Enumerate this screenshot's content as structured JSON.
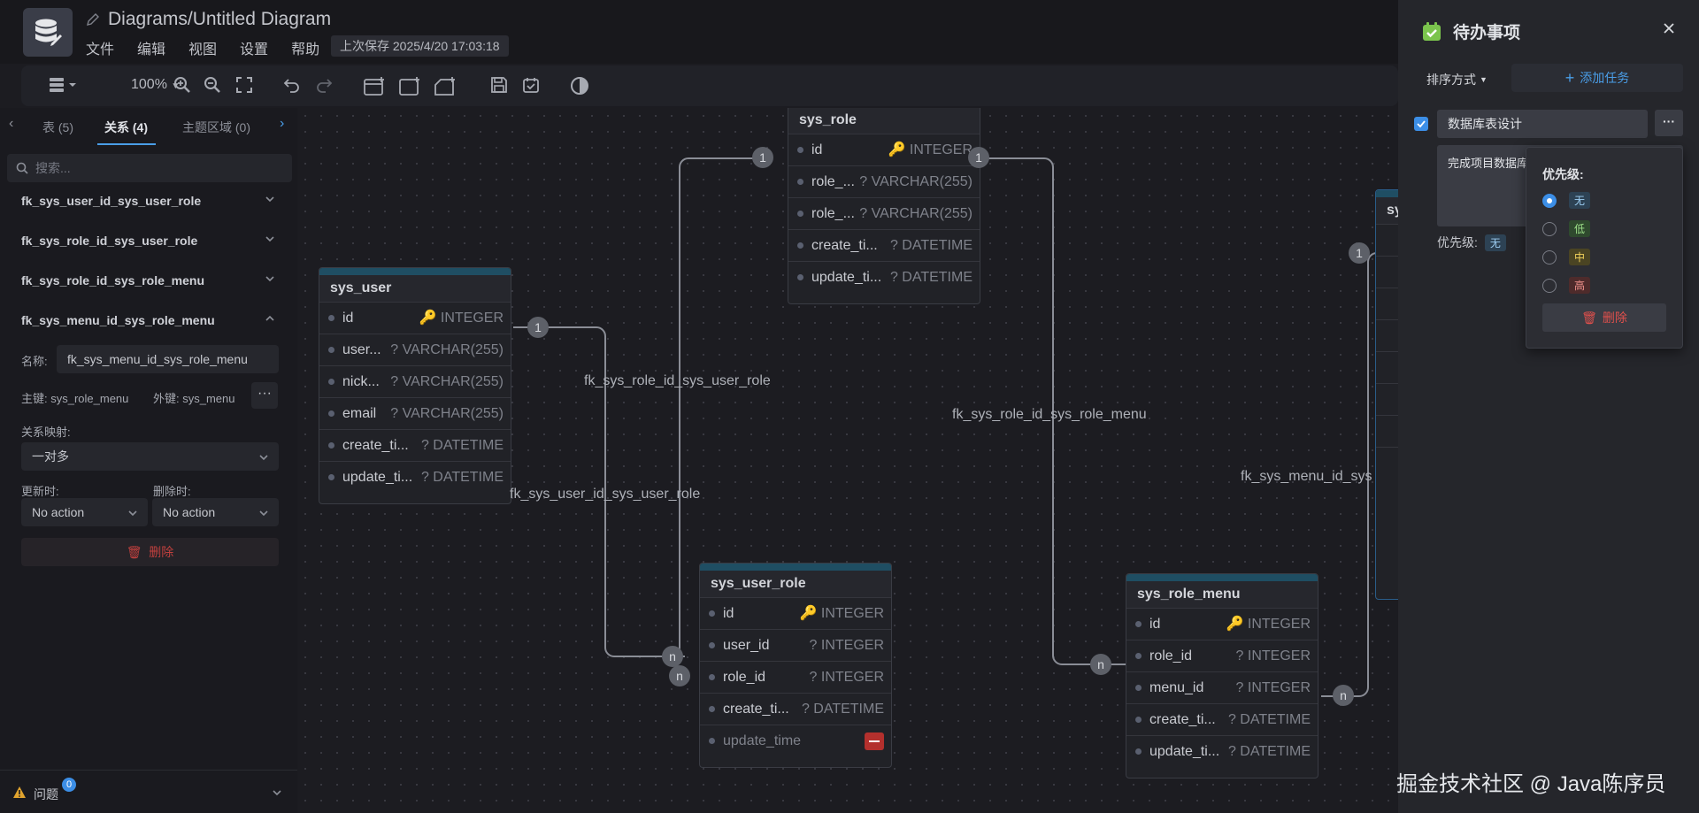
{
  "header": {
    "doc_title": "Diagrams/Untitled Diagram",
    "menu": [
      "文件",
      "编辑",
      "视图",
      "设置",
      "帮助"
    ],
    "last_saved": "上次保存 2025/4/20 17:03:18"
  },
  "toolbar": {
    "zoom": "100%"
  },
  "sidebar": {
    "tabs": [
      {
        "label": "表 (5)"
      },
      {
        "label": "关系 (4)"
      },
      {
        "label": "主题区域 (0)"
      }
    ],
    "search_placeholder": "搜索...",
    "relations": [
      {
        "name": "fk_sys_user_id_sys_user_role"
      },
      {
        "name": "fk_sys_role_id_sys_user_role"
      },
      {
        "name": "fk_sys_role_id_sys_role_menu"
      },
      {
        "name": "fk_sys_menu_id_sys_role_menu"
      }
    ],
    "detail": {
      "name_label": "名称:",
      "name_value": "fk_sys_menu_id_sys_role_menu",
      "primary_label": "主键: sys_role_menu",
      "foreign_label": "外键: sys_menu",
      "mapping_label": "关系映射:",
      "mapping_value": "一对多",
      "update_label": "更新时:",
      "update_value": "No action",
      "delete_label": "删除时:",
      "delete_value": "No action",
      "delete_button": "删除"
    },
    "issues": {
      "label": "问题",
      "count": "0"
    }
  },
  "canvas": {
    "tables": {
      "sys_role": {
        "title": "sys_role",
        "fields": [
          {
            "name": "id",
            "type": "🔑 INTEGER"
          },
          {
            "name": "role_...",
            "type": "? VARCHAR(255)"
          },
          {
            "name": "role_...",
            "type": "? VARCHAR(255)"
          },
          {
            "name": "create_ti...",
            "type": "? DATETIME"
          },
          {
            "name": "update_ti...",
            "type": "? DATETIME"
          }
        ]
      },
      "sys_user": {
        "title": "sys_user",
        "fields": [
          {
            "name": "id",
            "type": "🔑 INTEGER"
          },
          {
            "name": "user...",
            "type": "? VARCHAR(255)"
          },
          {
            "name": "nick...",
            "type": "? VARCHAR(255)"
          },
          {
            "name": "email",
            "type": "? VARCHAR(255)"
          },
          {
            "name": "create_ti...",
            "type": "? DATETIME"
          },
          {
            "name": "update_ti...",
            "type": "? DATETIME"
          }
        ]
      },
      "sys_user_role": {
        "title": "sys_user_role",
        "fields": [
          {
            "name": "id",
            "type": "🔑 INTEGER"
          },
          {
            "name": "user_id",
            "type": "? INTEGER"
          },
          {
            "name": "role_id",
            "type": "? INTEGER"
          },
          {
            "name": "create_ti...",
            "type": "? DATETIME"
          },
          {
            "name": "update_time",
            "type": ""
          }
        ]
      },
      "sys_role_menu": {
        "title": "sys_role_menu",
        "fields": [
          {
            "name": "id",
            "type": "🔑 INTEGER"
          },
          {
            "name": "role_id",
            "type": "? INTEGER"
          },
          {
            "name": "menu_id",
            "type": "? INTEGER"
          },
          {
            "name": "create_ti...",
            "type": "? DATETIME"
          },
          {
            "name": "update_ti...",
            "type": "? DATETIME"
          }
        ]
      },
      "sys_menu": {
        "title": "sys"
      }
    },
    "relation_labels": {
      "r1": "fk_sys_role_id_sys_user_role",
      "r2": "fk_sys_role_id_sys_role_menu",
      "r3": "fk_sys_user_id_sys_user_role",
      "r4": "fk_sys_menu_id_sys"
    },
    "cardinality": {
      "one": "1",
      "many": "n"
    }
  },
  "todo": {
    "title": "待办事项",
    "sort_label": "排序方式",
    "add_label": "添加任务",
    "task": {
      "title": "数据库表设计",
      "desc": "完成项目数据库",
      "priority_label": "优先级:",
      "priority_value": "无"
    },
    "popup": {
      "title": "优先级:",
      "options": [
        "无",
        "低",
        "中",
        "高"
      ],
      "delete_label": "删除"
    }
  },
  "watermark": "掘金技术社区 @ Java陈序员",
  "colors": {
    "accent": "#3c8ee6",
    "danger": "#e0504c",
    "table_header": "#1f4e63"
  }
}
